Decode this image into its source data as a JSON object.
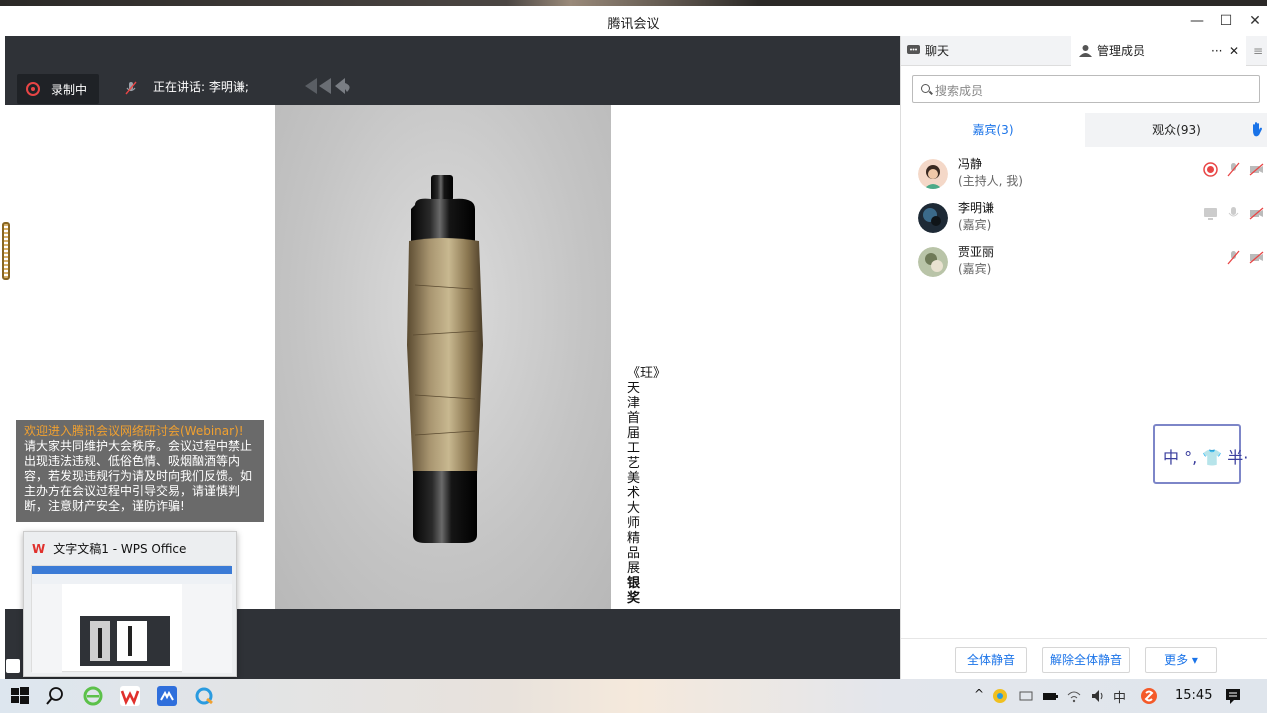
{
  "window": {
    "title": "腾讯会议",
    "minimize": "—",
    "maximize": "☐",
    "close": "✕"
  },
  "video": {
    "recording_label": "录制中",
    "speaking_label": "正在讲话: 李明谦;",
    "caption_line1": "《玨》天津首届工艺美术大师精品展",
    "caption_line2": "银奖",
    "notice_highlight": "欢迎进入腾讯会议网络研讨会(Webinar)!",
    "notice_body": "请大家共同维护大会秩序。会议过程中禁止出现违法违规、低俗色情、吸烟酗酒等内容，若发现违规行为请及时向我们反馈。如主办方在会议过程中引导交易，请谨慎判断，注意财产安全，谨防诈骗!"
  },
  "wps_preview": {
    "title": "文字文稿1 - WPS Office"
  },
  "side": {
    "tab_chat": "聊天",
    "tab_members": "管理成员",
    "tab_more": "···",
    "tab_close": "✕",
    "search_placeholder": "搜索成员",
    "tab_guests": "嘉宾(3)",
    "tab_audience": "观众(93)",
    "members": [
      {
        "name": "冯静",
        "role": "(主持人, 我)"
      },
      {
        "name": "李明谦",
        "role": "(嘉宾)"
      },
      {
        "name": "贾亚丽",
        "role": "(嘉宾)"
      }
    ],
    "btn_mute_all": "全体静音",
    "btn_unmute_all": "解除全体静音",
    "btn_more": "更多 ▾",
    "ime_text": "中 °, 👕 半·"
  },
  "taskbar": {
    "time": "15:45",
    "ime_char": "中"
  },
  "colors": {
    "accent": "#1a73e8",
    "record": "#e84545",
    "dark_bar": "#2f3237"
  }
}
